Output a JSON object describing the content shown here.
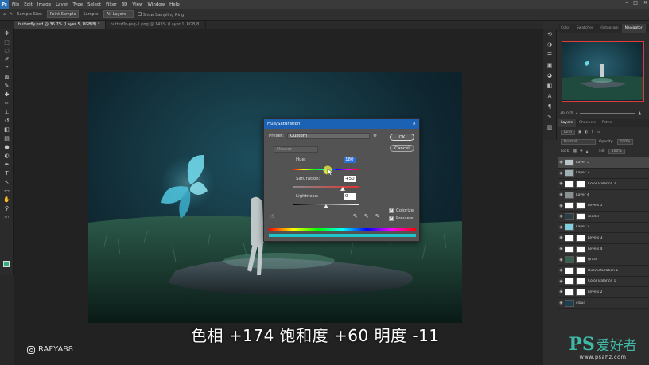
{
  "menubar": {
    "items": [
      "File",
      "Edit",
      "Image",
      "Layer",
      "Type",
      "Select",
      "Filter",
      "3D",
      "View",
      "Window",
      "Help"
    ],
    "window_controls": [
      "–",
      "□",
      "✕"
    ]
  },
  "options_bar": {
    "sample_size_label": "Sample Size:",
    "sample_size_value": "Point Sample",
    "sample_label": "Sample:",
    "sample_value": "All Layers",
    "show_ring_label": "Show Sampling Ring"
  },
  "document_tabs": [
    {
      "label": "butterfly.psd @ 36.7% (Layer 5, RGB/8) *",
      "active": true
    },
    {
      "label": "butterfly-psg-1.png @ 143% (Layer 1, RGB/8)",
      "active": false
    }
  ],
  "subtitle": "色相 +174 饱和度 +60 明度 -11",
  "watermark": "RAFYA88",
  "hue_saturation": {
    "title": "Hue/Saturation",
    "close": "✕",
    "preset_label": "Preset:",
    "preset_value": "Custom",
    "gear": "⚙",
    "channel": "Master",
    "hue_label": "Hue:",
    "hue_value": "180",
    "saturation_label": "Saturation:",
    "saturation_value": "+50",
    "lightness_label": "Lightness:",
    "lightness_value": "0",
    "hue_level": 0.5,
    "saturation_level": 0.75,
    "lightness_level": 0.5,
    "colorize_label": "Colorize",
    "colorize_checked": true,
    "preview_label": "Preview",
    "preview_checked": true,
    "ok_label": "OK",
    "cancel_label": "Cancel"
  },
  "navigator": {
    "tabs": [
      "Color",
      "Swatches",
      "Histogram",
      "Navigator"
    ],
    "active_tab": "Navigator",
    "zoom": "36.74%"
  },
  "layers_panel": {
    "tabs": [
      "Layers",
      "Channels",
      "Paths"
    ],
    "active_tab": "Layers",
    "filter_label": "Kind",
    "blend_mode": "Normal",
    "opacity_label": "Opacity:",
    "opacity_value": "100%",
    "lock_label": "Lock:",
    "fill_label": "Fill:",
    "fill_value": "100%",
    "layers": [
      {
        "name": "Layer 5",
        "selected": true,
        "mask": false
      },
      {
        "name": "Layer 3",
        "selected": false,
        "mask": false
      },
      {
        "name": "Color Balance 2",
        "selected": false,
        "mask": true
      },
      {
        "name": "Layer 4",
        "selected": false,
        "mask": false
      },
      {
        "name": "Levels 1",
        "selected": false,
        "mask": true
      },
      {
        "name": "model",
        "selected": false,
        "mask": true
      },
      {
        "name": "Layer 2",
        "selected": false,
        "mask": false
      },
      {
        "name": "Levels 3",
        "selected": false,
        "mask": true
      },
      {
        "name": "Levels 4",
        "selected": false,
        "mask": true
      },
      {
        "name": "grass",
        "selected": false,
        "mask": true
      },
      {
        "name": "Hue/Saturation 1",
        "selected": false,
        "mask": true
      },
      {
        "name": "Color Balance 1",
        "selected": false,
        "mask": true
      },
      {
        "name": "Levels 2",
        "selected": false,
        "mask": true
      },
      {
        "name": "cloud",
        "selected": false,
        "mask": false
      }
    ]
  },
  "site_logo": {
    "ps": "PS",
    "cn": "爱好者",
    "url": "www.psahz.com"
  },
  "colors": {
    "accent": "#1b62b5",
    "foreground_swatch": "#2fae7a",
    "logo": "#3fb8a6"
  }
}
